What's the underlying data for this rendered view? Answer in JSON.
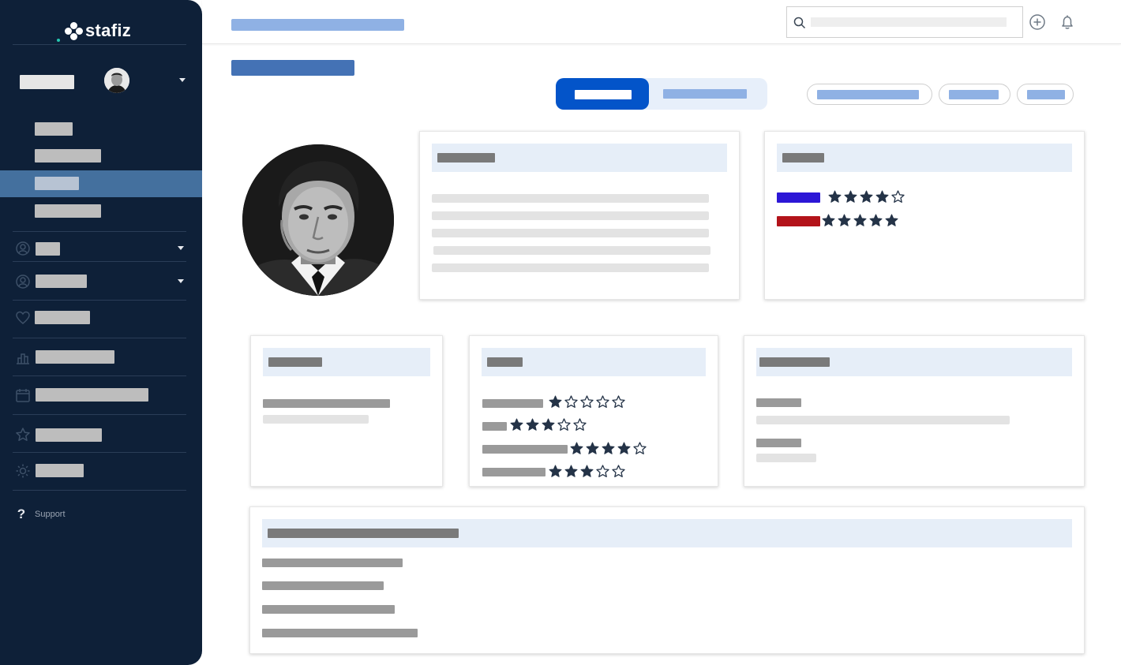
{
  "app": {
    "brand": "stafiz",
    "support_label": "Support"
  },
  "colors": {
    "sidebar_bg": "#0e2038",
    "sidebar_active": "#44709e",
    "accent": "#0354c9",
    "placeholder_blue": "#8fb1e4",
    "skill_blue": "#2c17d6",
    "skill_red": "#b3131a",
    "star_dark": "#243347"
  },
  "sidebar": {
    "active_item_index": 2,
    "nav_icons": [
      "user-circle-icon",
      "user-circle-icon",
      "heart-icon",
      "chart-icon",
      "calendar-icon",
      "star-icon",
      "sun-icon"
    ]
  },
  "header": {
    "icons": [
      "search-icon",
      "add-circle-icon",
      "bell-icon"
    ]
  },
  "tabs": {
    "active_index": 0,
    "count": 2
  },
  "ratings": {
    "languages": [
      {
        "color": "blue",
        "stars": 4,
        "max": 5
      },
      {
        "color": "red",
        "stars": 5,
        "max": 5
      }
    ],
    "skills": [
      {
        "stars": 1,
        "max": 5
      },
      {
        "stars": 3,
        "max": 5
      },
      {
        "stars": 4,
        "max": 5
      },
      {
        "stars": 3,
        "max": 5
      }
    ]
  }
}
